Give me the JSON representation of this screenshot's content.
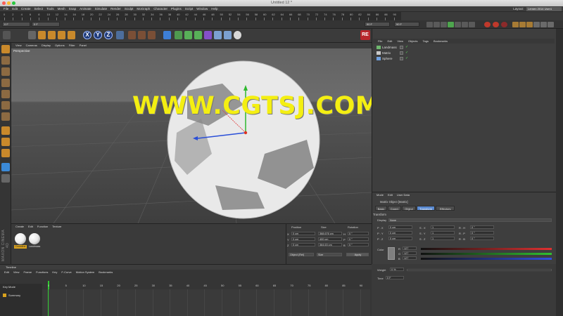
{
  "window": {
    "title": "Untitled 12 *"
  },
  "menubar": {
    "items": [
      "File",
      "Edit",
      "Create",
      "Select",
      "Tools",
      "Mesh",
      "Snap",
      "Animate",
      "Simulate",
      "Render",
      "Sculpt",
      "MoGraph",
      "Character",
      "Plugins",
      "Script",
      "Window",
      "Help"
    ],
    "layout_label": "Layout:",
    "layout_value": "Lernen 2014 User1"
  },
  "ruler_top": {
    "labels": [
      "0",
      "2",
      "4",
      "6",
      "8",
      "10",
      "12",
      "14",
      "16",
      "18",
      "20",
      "22",
      "24",
      "26",
      "28",
      "30",
      "32",
      "34",
      "36",
      "38",
      "40",
      "42",
      "44",
      "46",
      "48",
      "50",
      "52",
      "54",
      "56",
      "58",
      "60",
      "62",
      "64",
      "66",
      "68",
      "70",
      "72",
      "74",
      "76",
      "78",
      "80",
      "82",
      "84",
      "86",
      "88",
      "90"
    ]
  },
  "transport": {
    "start_frame": "0 F",
    "current_frame": "0 F",
    "end_frame": "90 F",
    "end_frame2": "90 F"
  },
  "viewport": {
    "menu": [
      "View",
      "Cameras",
      "Display",
      "Options",
      "Filter",
      "Panel"
    ],
    "label": "Perspective",
    "watermark": "WWW.CGTSJ.COM",
    "re_badge": "RE"
  },
  "objects": {
    "menu": [
      "File",
      "Edit",
      "View",
      "Objects",
      "Tags",
      "Bookmarks"
    ],
    "items": [
      {
        "name": "Landmass",
        "color": "#6fb86f"
      },
      {
        "name": "Matrix",
        "color": "#c9c9c9"
      },
      {
        "name": "Sphere",
        "color": "#6fa0e0"
      }
    ]
  },
  "attributes": {
    "menu": [
      "Mode",
      "Edit",
      "User Data"
    ],
    "object_title": "Matrix Object [Matrix]",
    "tabs": [
      "Basic",
      "Coord.",
      "Object",
      "Transform",
      "Effectors"
    ],
    "active_tab": "Transform",
    "section": "Transform",
    "display_label": "Display",
    "display_value": "None",
    "rows": [
      {
        "p": "P . X",
        "pv": "0 cm",
        "s": "S . X",
        "sv": "1",
        "r": "R . H",
        "rv": "0 °"
      },
      {
        "p": "P . Y",
        "pv": "0 cm",
        "s": "S . Y",
        "sv": "1",
        "r": "R . P",
        "rv": "0 °"
      },
      {
        "p": "P . Z",
        "pv": "0 cm",
        "s": "S . Z",
        "sv": "1",
        "r": "R . B",
        "rv": "0 °"
      }
    ],
    "color_label": "Color",
    "color_channels": [
      {
        "ch": "R",
        "value": "127",
        "color": "#e03030"
      },
      {
        "ch": "G",
        "value": "127",
        "color": "#30c030"
      },
      {
        "ch": "B",
        "value": "127",
        "color": "#3050e0"
      }
    ],
    "weight_label": "Weight",
    "weight_value": "0 %",
    "time_label": "Time",
    "time_value": "0 F"
  },
  "materials": {
    "menu": [
      "Create",
      "Edit",
      "Function",
      "Texture"
    ],
    "items": [
      {
        "label": "Crossline",
        "color": "#f0f0f0"
      },
      {
        "label": "Landmass",
        "color": "#e8e8e8"
      }
    ],
    "side_brand": "MAXON CINEMA 4D"
  },
  "coordinates": {
    "headers": [
      "Position",
      "Size",
      "Rotation"
    ],
    "rows": [
      {
        "axis": "X",
        "pos": "0 cm",
        "size": "368.676 cm",
        "rot_axis": "H",
        "rot": "0 °"
      },
      {
        "axis": "Y",
        "pos": "0 cm",
        "size": "400 cm",
        "rot_axis": "P",
        "rot": "0 °"
      },
      {
        "axis": "Z",
        "pos": "0 cm",
        "size": "364.63 cm",
        "rot_axis": "B",
        "rot": "0 °"
      }
    ],
    "mode_select": "Object (Rel)",
    "size_select": "Size",
    "apply_label": "Apply"
  },
  "timeline": {
    "title": "Timeline",
    "menu": [
      "Edit",
      "View",
      "Frame",
      "Functions",
      "Key",
      "F-Curve",
      "Motion System",
      "Bookmarks"
    ],
    "key_mode": "Key Mode",
    "summary": "Summary",
    "ruler": [
      "0",
      "5",
      "10",
      "15",
      "20",
      "25",
      "30",
      "35",
      "40",
      "45",
      "50",
      "55",
      "60",
      "65",
      "70",
      "75",
      "80",
      "85",
      "90"
    ]
  }
}
